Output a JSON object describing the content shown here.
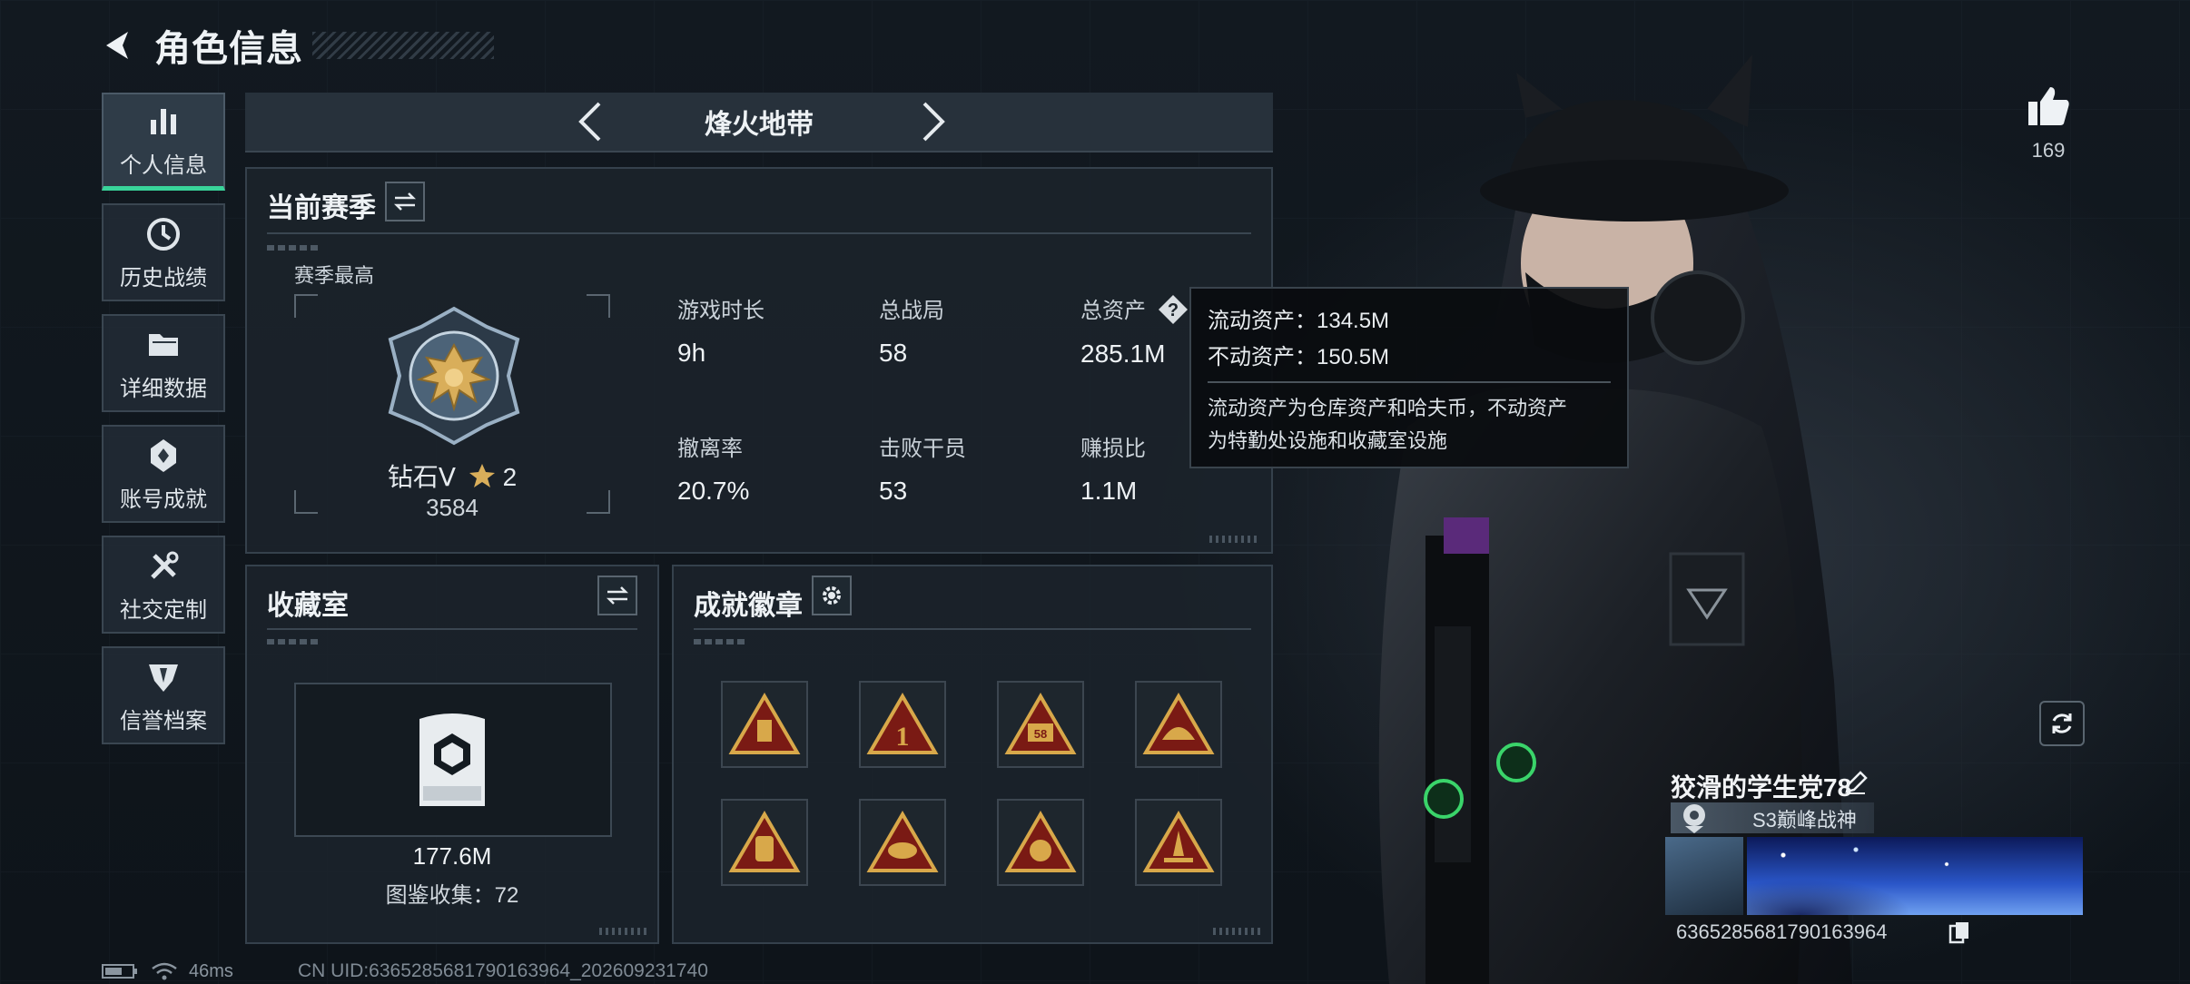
{
  "header": {
    "title": "角色信息"
  },
  "sidebar": {
    "items": [
      {
        "label": "个人信息",
        "icon": "bar-chart-icon",
        "active": true
      },
      {
        "label": "历史战绩",
        "icon": "clock-icon",
        "active": false
      },
      {
        "label": "详细数据",
        "icon": "folder-icon",
        "active": false
      },
      {
        "label": "账号成就",
        "icon": "achievement-icon",
        "active": false
      },
      {
        "label": "社交定制",
        "icon": "tools-icon",
        "active": false
      },
      {
        "label": "信誉档案",
        "icon": "shield-icon",
        "active": false
      }
    ]
  },
  "map_selector": {
    "name": "烽火地带"
  },
  "season": {
    "title": "当前赛季",
    "best_label": "赛季最高",
    "rank": "钻石Ⅴ",
    "stars": "2",
    "score": "3584",
    "stats": [
      {
        "label": "游戏时长",
        "value": "9h"
      },
      {
        "label": "总战局",
        "value": "58"
      },
      {
        "label": "总资产",
        "value": "285.1M"
      },
      {
        "label": "撤离率",
        "value": "20.7%"
      },
      {
        "label": "击败干员",
        "value": "53"
      },
      {
        "label": "赚损比",
        "value": "1.1M"
      }
    ]
  },
  "tooltip": {
    "liquid": "流动资产：134.5M",
    "fixed": "不动资产：150.5M",
    "desc_line1": "流动资产为仓库资产和哈夫币，不动资产",
    "desc_line2": "为特勤处设施和收藏室设施"
  },
  "collection": {
    "title": "收藏室",
    "value": "177.6M",
    "count": "图鉴收集：72"
  },
  "achievements": {
    "title": "成就徽章",
    "badges": [
      "backpack-badge",
      "rank-one-badge",
      "fifty-eight-badge",
      "helmet-badge",
      "bag-badge",
      "fish-badge",
      "crest-badge",
      "missile-badge"
    ]
  },
  "profile": {
    "likes": "169",
    "player_name": "狡滑的学生党78",
    "title": "S3巅峰战神",
    "uid": "6365285681790163964"
  },
  "status": {
    "ping": "46ms",
    "uid_line": "CN UID:6365285681790163964_202609231740"
  },
  "colors": {
    "accent": "#39d49a",
    "badge_red": "#7a1a14",
    "badge_gold": "#d8a84a"
  }
}
